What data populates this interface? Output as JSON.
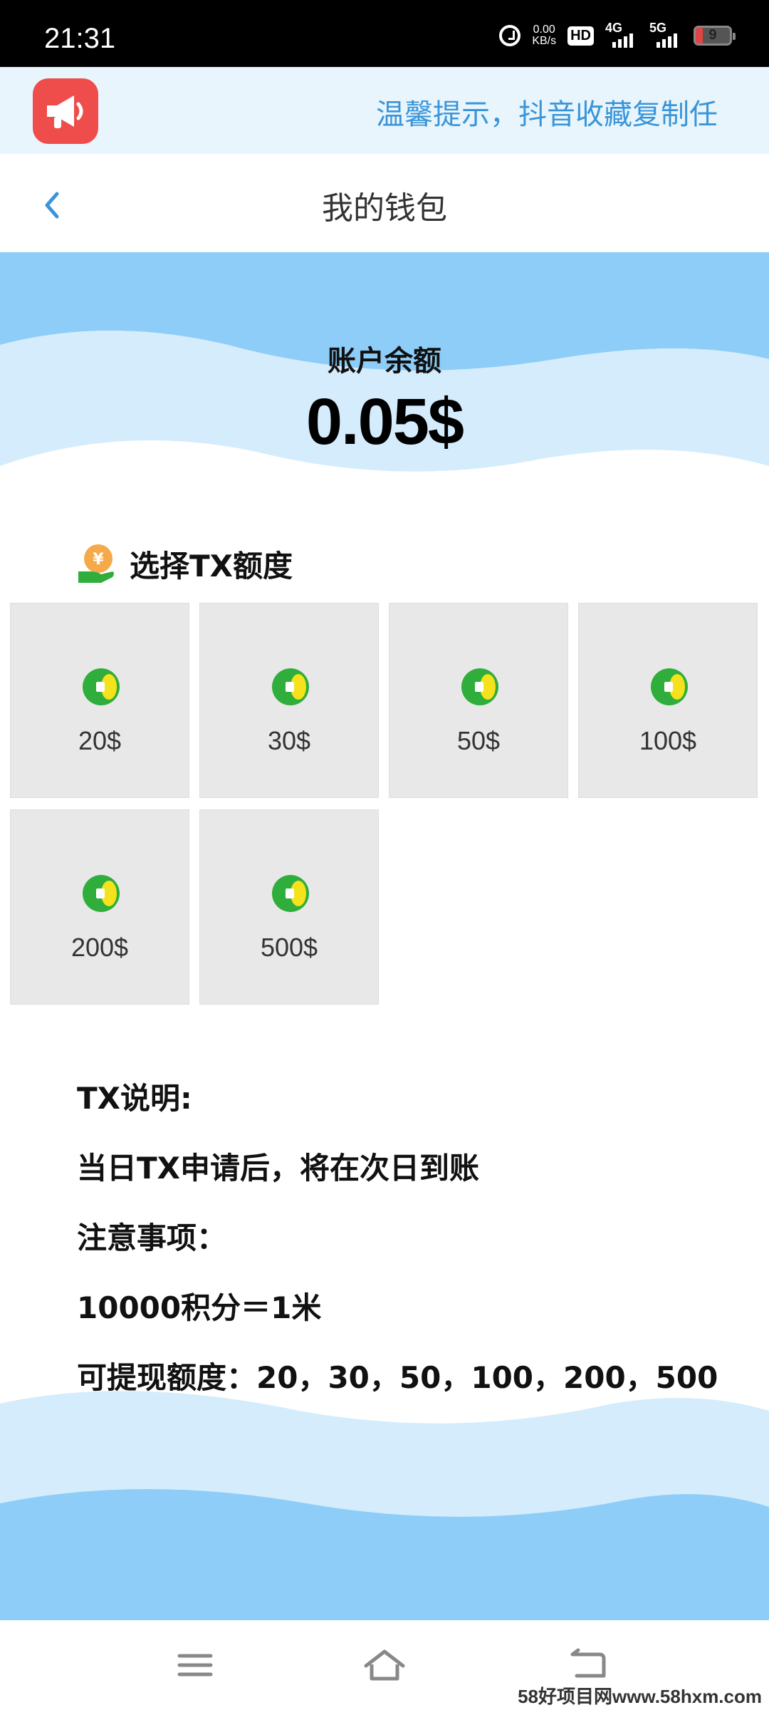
{
  "status_bar": {
    "time": "21:31",
    "net_speed_value": "0.00",
    "net_speed_unit": "KB/s",
    "hd_label": "HD",
    "sim1_label": "4G",
    "sim2_label": "5G",
    "battery": "9"
  },
  "notice": {
    "icon": "megaphone-icon",
    "text": "温馨提示，抖音收藏复制任"
  },
  "header": {
    "back_icon": "chevron-left-icon",
    "title": "我的钱包"
  },
  "balance": {
    "label": "账户余额",
    "amount": "0.05$"
  },
  "section": {
    "icon": "yuan-hand-icon",
    "title": "选择TX额度"
  },
  "options": [
    {
      "label": "20$"
    },
    {
      "label": "30$"
    },
    {
      "label": "50$"
    },
    {
      "label": "100$"
    },
    {
      "label": "200$"
    },
    {
      "label": "500$"
    }
  ],
  "info": {
    "heading": "TX说明:",
    "line1": "当日TX申请后，将在次日到账",
    "notice_heading": "注意事项：",
    "line2": "10000积分＝1米",
    "line3": "可提现额度：20，30，50，100，200，500"
  },
  "nav": {
    "menu_icon": "menu-icon",
    "home_icon": "home-icon",
    "back_icon": "back-icon"
  },
  "watermark": "58好项目网www.58hxm.com",
  "colors": {
    "accent_blue": "#3a95d8",
    "wave_dark": "#8dcdf7",
    "wave_light": "#d4ecfc",
    "notice_bg": "#e8f5fd",
    "megaphone_red": "#ef4c4c",
    "card_bg": "#e8e8e8",
    "coin_green": "#2fae3c",
    "coin_yellow": "#f5e11c"
  }
}
